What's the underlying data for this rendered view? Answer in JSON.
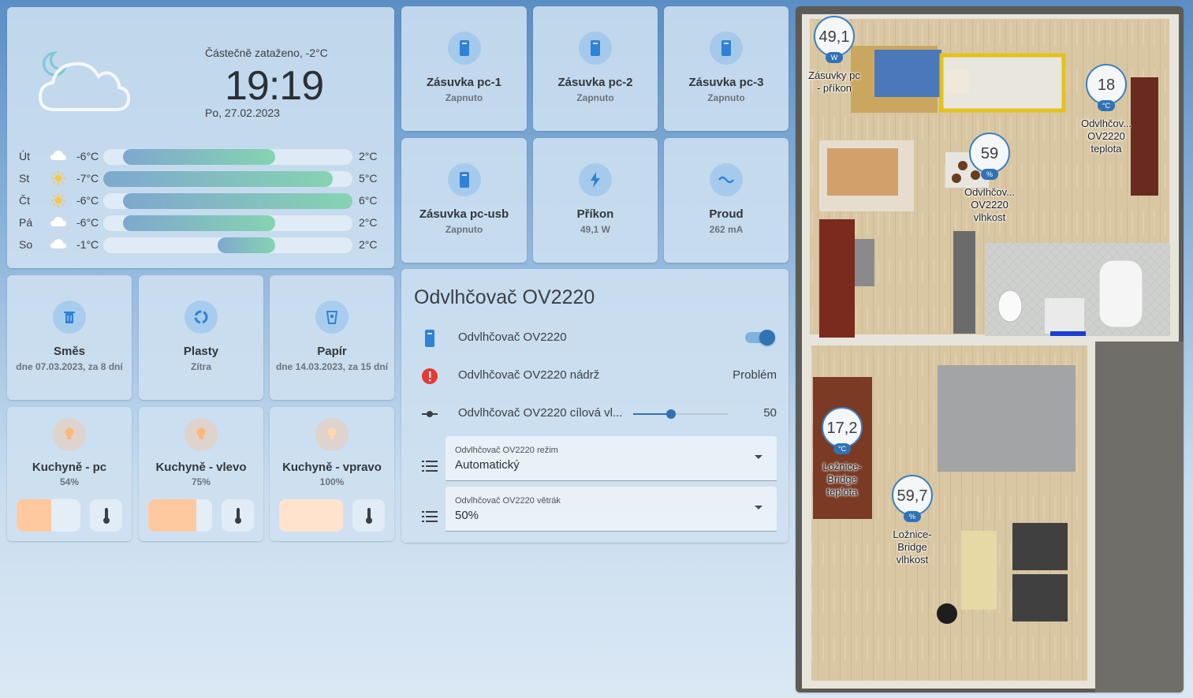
{
  "weather": {
    "condition": "Částečně zataženo, -2°C",
    "time": "19:19",
    "date": "Po, 27.02.2023",
    "forecast": [
      {
        "day": "Út",
        "icon": "cloud-icon",
        "low": "-6°C",
        "high": "2°C",
        "bar_start": 0.08,
        "bar_end": 0.69
      },
      {
        "day": "St",
        "icon": "sun-icon",
        "low": "-7°C",
        "high": "5°C",
        "bar_start": 0.0,
        "bar_end": 0.92
      },
      {
        "day": "Čt",
        "icon": "sun-icon",
        "low": "-6°C",
        "high": "6°C",
        "bar_start": 0.08,
        "bar_end": 1.0
      },
      {
        "day": "Pá",
        "icon": "cloud-icon",
        "low": "-6°C",
        "high": "2°C",
        "bar_start": 0.08,
        "bar_end": 0.69
      },
      {
        "day": "So",
        "icon": "cloud-icon",
        "low": "-1°C",
        "high": "2°C",
        "bar_start": 0.46,
        "bar_end": 0.69
      }
    ]
  },
  "switch_tiles": [
    {
      "name": "Zásuvka pc-1",
      "state": "Zapnuto",
      "icon": "power-socket-icon"
    },
    {
      "name": "Zásuvka pc-2",
      "state": "Zapnuto",
      "icon": "power-socket-icon"
    },
    {
      "name": "Zásuvka pc-3",
      "state": "Zapnuto",
      "icon": "power-socket-icon"
    },
    {
      "name": "Zásuvka pc-usb",
      "state": "Zapnuto",
      "icon": "power-socket-icon"
    },
    {
      "name": "Příkon",
      "state": "49,1 W",
      "icon": "lightning-icon"
    },
    {
      "name": "Proud",
      "state": "262 mA",
      "icon": "current-wave-icon"
    }
  ],
  "waste_tiles": [
    {
      "name": "Směs",
      "state": "dne 07.03.2023, za 8 dní",
      "icon": "trash-can-icon"
    },
    {
      "name": "Plasty",
      "state": "Zítra",
      "icon": "recycle-icon"
    },
    {
      "name": "Papír",
      "state": "dne 14.03.2023, za 15 dní",
      "icon": "paper-bin-icon"
    }
  ],
  "light_tiles": [
    {
      "name": "Kuchyně - pc",
      "state": "54%",
      "brightness": 0.54
    },
    {
      "name": "Kuchyně - vlevo",
      "state": "75%",
      "brightness": 0.75
    },
    {
      "name": "Kuchyně - vpravo",
      "state": "100%",
      "brightness": 1.0
    }
  ],
  "dehumidifier": {
    "title": "Odvlhčovač OV2220",
    "switch_name": "Odvlhčovač OV2220",
    "switch_on": true,
    "tank_name": "Odvlhčovač OV2220 nádrž",
    "tank_state": "Problém",
    "target_name": "Odvlhčovač OV2220 cílová vl...",
    "target_value": "50",
    "target_fraction": 0.4,
    "mode_label": "Odvlhčovač OV2220 režim",
    "mode_value": "Automatický",
    "fan_label": "Odvlhčovač OV2220 větrák",
    "fan_value": "50%"
  },
  "floorplan": {
    "badges": [
      {
        "value": "49,1",
        "unit": "W",
        "label": "Zásuvky pc - příkon"
      },
      {
        "value": "18",
        "unit": "°C",
        "label": "Odvlhčov... OV2220 teplota"
      },
      {
        "value": "59",
        "unit": "%",
        "label": "Odvlhčov... OV2220 vlhkost"
      },
      {
        "value": "17,2",
        "unit": "°C",
        "label": "Ložnice-Bridge teplota"
      },
      {
        "value": "59,7",
        "unit": "%",
        "label": "Ložnice-Bridge vlhkost"
      }
    ]
  },
  "colors": {
    "accent": "#3b7fc0",
    "tile_icon": "#2f82d6",
    "warning": "#e53935"
  }
}
